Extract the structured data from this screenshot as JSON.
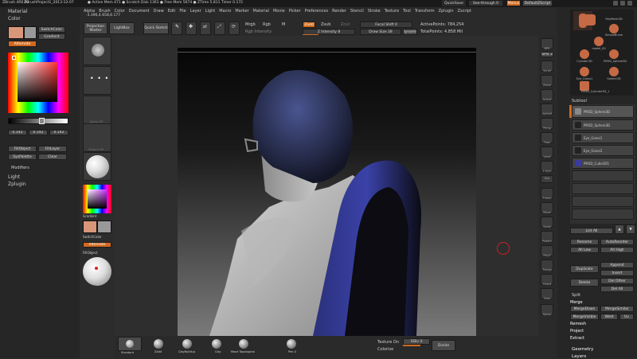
{
  "title_bar": {
    "app": "ZBrush 4R6 P2",
    "project": "ZBrushProject1_2013-12-07",
    "status": "● Active Mem 471 ● Scratch Disk 1361 ● Free Mem 5674 ● ZTime 5.811 Timer 0.172",
    "quicksave": "QuickSave",
    "see_through": "See-through 0",
    "menus": "Menus",
    "default_script": "DefaultZScript"
  },
  "menubar": {
    "items": [
      "Alpha",
      "Brush",
      "Color",
      "Document",
      "Draw",
      "Edit",
      "File",
      "Layer",
      "Light",
      "Macro",
      "Marker",
      "Material",
      "Movie",
      "Picker",
      "Preferences",
      "Render",
      "Stencil",
      "Stroke",
      "Texture",
      "Tool",
      "Transform",
      "Zplugin",
      "Zscript"
    ]
  },
  "coords": "-3.396,4.658,6.177",
  "left_panel": {
    "material": "Material",
    "color": "Color",
    "switch_color": "SwitchColor",
    "gradient": "Gradient",
    "alternate": "Alternate",
    "r": "0.142",
    "g": "0.142",
    "b": "0.142",
    "fill_object": "FillObject",
    "fill_layer": "FillLayer",
    "syspalette": "SysPalette",
    "clear": "Clear",
    "modifiers": "Modifiers",
    "light": "Light",
    "zplugin": "Zplugin"
  },
  "toolbar": {
    "projection_master": "Projection Master",
    "lightbox": "LightBox",
    "quick_sketch": "Quick Sketch",
    "edit": "Edit",
    "draw": "Draw",
    "move": "Move",
    "scale": "Scale",
    "rotate": "Rotate",
    "mrgb": "Mrgb",
    "rgb": "Rgb",
    "m": "M",
    "rgb_intensity": "Rgb Intensity",
    "zadd": "Zadd",
    "zsub": "Zsub",
    "zcut": "Zcut",
    "z_intensity": "Z Intensity 8",
    "focal_shift": "Focal Shift 0",
    "draw_size": "Draw Size 28",
    "dynamic": "Dynamic",
    "active_points": "ActivePoints: 784,254",
    "total_points": "TotalPoints: 4.858 Mil"
  },
  "tray": {
    "gradient": "Gradient",
    "switch_color": "SwitchColor",
    "alternate": "Alternate",
    "fill_object": "FillObject",
    "alpha_off": "Alpha Off",
    "texture_off": "Texture Off"
  },
  "right_shelf": [
    "BPR",
    "SPix 3",
    "Scroll",
    "Zoom",
    "Actual",
    "AAHalf",
    "Persp",
    "Floor",
    "Local",
    "L.Sym",
    "Xyz",
    "Frame",
    "Move",
    "Scale",
    "Rotate",
    "PolyF",
    "Transp",
    "Ghost",
    "Solo",
    "Xpose"
  ],
  "tool_panel": {
    "thumbs": [
      "PolyMesh3D",
      "SimpleBrush",
      "Cylinder3D",
      "model_00",
      "PM3D_Sphere3D",
      "Eye_Grass1",
      "Sphere3D",
      "PM3D_Cylinder3D_1"
    ],
    "subtool": "Subtool",
    "subtools": [
      {
        "name": "PM3D_Sphere3D",
        "color": "#505050"
      },
      {
        "name": "Eye_Grass1",
        "color": "#404040"
      },
      {
        "name": "Eye_Grass2",
        "color": "#404040"
      },
      {
        "name": "PM3D_Cube3D1",
        "color": "#3a3aa0"
      }
    ],
    "list_all": "List All",
    "rename": "Rename",
    "autoreorder": "AutoReorder",
    "all_low": "All Low",
    "all_high": "All High",
    "append": "Append",
    "duplicate": "Duplicate",
    "insert": "Insert",
    "delete": "Delete",
    "del_other": "Del Other",
    "del_all": "Del All",
    "split": "Split",
    "merge": "Merge",
    "merge_down": "MergeDown",
    "merge_similar": "MergeSimilar",
    "merge_visible": "MergeVisible",
    "weld": "Weld",
    "uv": "Uv",
    "remesh": "Remesh",
    "project": "Project",
    "extract": "Extract",
    "geometry": "Geometry",
    "layers": "Layers"
  },
  "bottom": {
    "brushes": [
      "Standard",
      "ClayBuildup",
      "Clay",
      "Move Topological",
      "Pen A"
    ],
    "first_brush": "ZAdd",
    "texture_on": "Texture On",
    "sdiv": "SDiv 3",
    "colorize": "Colorize",
    "divide": "Divide"
  }
}
